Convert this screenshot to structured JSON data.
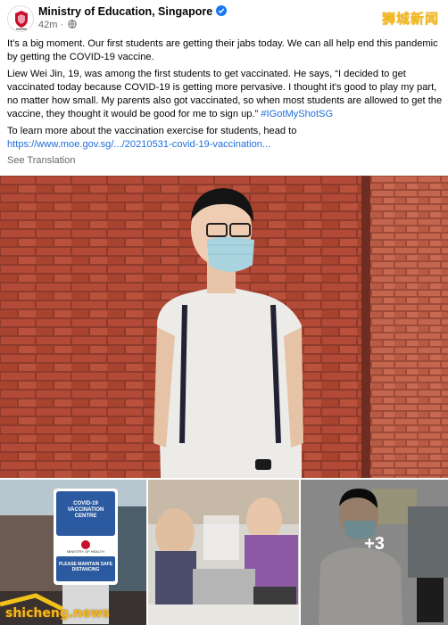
{
  "post": {
    "author": "Ministry of Education, Singapore",
    "timestamp": "42m",
    "privacy_icon": "globe-icon",
    "verified_icon": "verified-badge-icon",
    "watermark": "狮城新闻",
    "paragraph1": "It's a big moment. Our first students are getting their jabs today. We can all help end this pandemic by getting the COVID-19 vaccine.",
    "paragraph2": "Liew Wei Jin, 19, was among the first students to get vaccinated. He says, “I decided to get vaccinated today because COVID-19 is getting more pervasive. I thought it's good to play my part, no matter how small. My parents also got vaccinated, so when most students are allowed to get the vaccine, they thought it would be good for me to sign up.”",
    "hashtag": "#IGotMyShotSG",
    "paragraph3": "To learn more about the vaccination exercise for students, head to",
    "link": "https://www.moe.gov.sg/.../20210531-covid-19-vaccination...",
    "see_translation": "See Translation"
  },
  "photos": {
    "sign_title": "COVID-19 VACCINATION CENTRE",
    "sign_ministry": "MINISTRY OF HEALTH",
    "sign_notice": "PLEASE MAINTAIN SAFE DISTANCING",
    "more_count": "+3",
    "watermark": "shicheng.news"
  }
}
